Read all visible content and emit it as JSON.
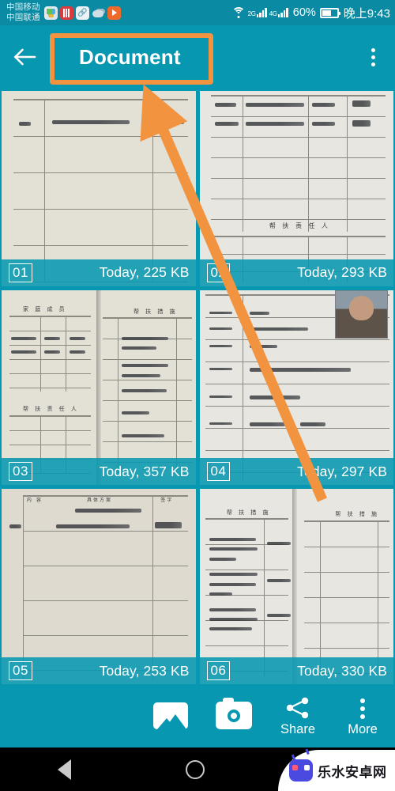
{
  "status_bar": {
    "carrier_line1": "中国移动",
    "carrier_line2": "中国联通",
    "icons": [
      "photos-icon",
      "news-icon",
      "link-icon",
      "weather-icon",
      "video-player-icon"
    ],
    "wifi": "wifi-icon",
    "sim1_network": "2G",
    "sim2_network": "4G",
    "battery_percent": "60%",
    "clock": "晚上9:43"
  },
  "app_bar": {
    "back_label": "back-arrow",
    "title": "Document",
    "overflow_label": "more-options"
  },
  "grid": {
    "items": [
      {
        "index": "01",
        "meta": "Today, 225 KB"
      },
      {
        "index": "02",
        "meta": "Today, 293 KB"
      },
      {
        "index": "03",
        "meta": "Today, 357 KB"
      },
      {
        "index": "04",
        "meta": "Today, 297 KB"
      },
      {
        "index": "05",
        "meta": "Today, 253 KB"
      },
      {
        "index": "06",
        "meta": "Today, 330 KB"
      }
    ]
  },
  "toolbar": {
    "gallery_label": "",
    "camera_label": "",
    "share_label": "Share",
    "more_label": "More"
  },
  "nav_bar": {
    "back": "nav-back-triangle",
    "home": "nav-home-circle",
    "recents": "nav-recents-square"
  },
  "watermark": {
    "text": "乐水安卓网"
  },
  "annotations": {
    "highlight_color": "#f2933f",
    "highlight_target": "Document",
    "arrow_from": "thumbnail-06",
    "arrow_to": "thumbnail-01"
  },
  "theme": {
    "accent": "#0897b0",
    "status_bar_bg": "#0a8ba3",
    "caption_text": "#ffffff",
    "nav_bg": "#000000"
  }
}
